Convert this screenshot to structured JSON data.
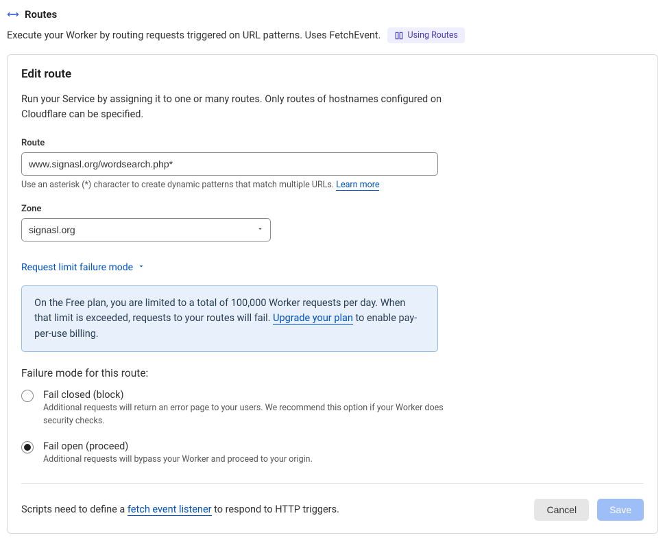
{
  "header": {
    "title": "Routes",
    "subtitle": "Execute your Worker by routing requests triggered on URL patterns. Uses FetchEvent.",
    "docs_label": "Using Routes"
  },
  "edit": {
    "title": "Edit route",
    "desc": "Run your Service by assigning it to one or many routes. Only routes of hostnames configured on Cloudflare can be specified."
  },
  "route": {
    "label": "Route",
    "value": "www.signasl.org/wordsearch.php*",
    "help_prefix": "Use an asterisk (*) character to create dynamic patterns that match multiple URLs. ",
    "help_link": "Learn more"
  },
  "zone": {
    "label": "Zone",
    "value": "signasl.org"
  },
  "expand_label": "Request limit failure mode",
  "banner": {
    "part1": "On the Free plan, you are limited to a total of 100,000 Worker requests per day. When that limit is exceeded, requests to your routes will fail. ",
    "upgrade_link": "Upgrade your plan",
    "part2": " to enable pay-per-use billing."
  },
  "failure": {
    "heading": "Failure mode for this route:",
    "options": [
      {
        "title": "Fail closed (block)",
        "desc": "Additional requests will return an error page to your users. We recommend this option if your Worker does security checks.",
        "selected": false
      },
      {
        "title": "Fail open (proceed)",
        "desc": "Additional requests will bypass your Worker and proceed to your origin.",
        "selected": true
      }
    ]
  },
  "footer": {
    "prefix": "Scripts need to define a ",
    "link": "fetch event listener",
    "suffix": " to respond to HTTP triggers."
  },
  "buttons": {
    "cancel": "Cancel",
    "save": "Save"
  }
}
